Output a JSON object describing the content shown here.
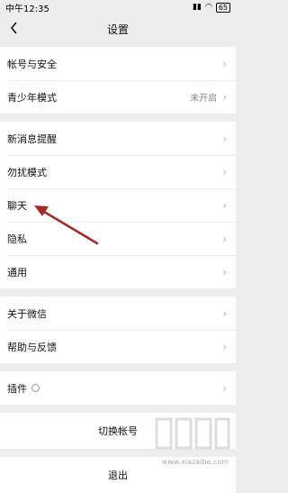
{
  "status": {
    "time": "中午12:35",
    "battery": "65"
  },
  "header": {
    "title": "设置"
  },
  "groups": [
    {
      "items": [
        {
          "label": "帐号与安全"
        },
        {
          "label": "青少年模式",
          "value": "未开启"
        }
      ]
    },
    {
      "items": [
        {
          "label": "新消息提醒"
        },
        {
          "label": "勿扰模式"
        },
        {
          "label": "聊天"
        },
        {
          "label": "隐私"
        },
        {
          "label": "通用"
        }
      ]
    },
    {
      "items": [
        {
          "label": "关于微信"
        },
        {
          "label": "帮助与反馈"
        }
      ]
    },
    {
      "items": [
        {
          "label": "插件"
        }
      ]
    }
  ],
  "actions": {
    "switch_account": "切换帐号",
    "logout": "退出"
  },
  "watermark": {
    "url": "www.xiazaiba.com"
  },
  "colors": {
    "arrow": "#a52a26",
    "background": "#ededed"
  }
}
